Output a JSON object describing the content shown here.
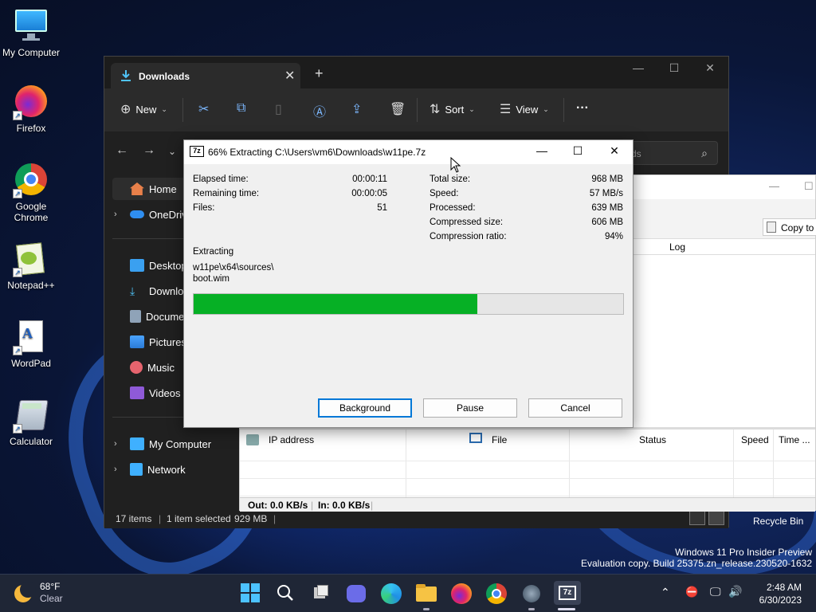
{
  "desktop": {
    "icons": [
      {
        "label": "My Computer"
      },
      {
        "label": "Firefox"
      },
      {
        "label": "Google Chrome"
      },
      {
        "label": "Notepad++"
      },
      {
        "label": "WordPad"
      },
      {
        "label": "Calculator"
      }
    ],
    "recycle_bin": "Recycle Bin",
    "watermark_line1": "Windows 11 Pro Insider Preview",
    "watermark_line2": "Evaluation copy. Build 25375.zn_release.230520-1632"
  },
  "explorer": {
    "tab_title": "Downloads",
    "toolbar": {
      "new_label": "New",
      "sort_label": "Sort",
      "view_label": "View"
    },
    "search_placeholder": "ds",
    "sidebar": {
      "items": [
        {
          "label": "Home"
        },
        {
          "label": "OneDriv"
        },
        {
          "label": "Desktop"
        },
        {
          "label": "Downloa"
        },
        {
          "label": "Docume"
        },
        {
          "label": "Pictures"
        },
        {
          "label": "Music"
        },
        {
          "label": "Videos"
        },
        {
          "label": "My Computer"
        },
        {
          "label": "Network"
        }
      ]
    },
    "status": {
      "items": "17 items",
      "selected": "1 item selected",
      "size": "929 MB"
    }
  },
  "network_window": {
    "copy_to": "Copy to",
    "log_header": "Log",
    "columns": [
      "IP address",
      "File",
      "Status",
      "Speed",
      "Time ..."
    ],
    "out_speed": "Out: 0.0 KB/s",
    "in_speed": "In: 0.0 KB/s"
  },
  "zip_dialog": {
    "title": "66% Extracting C:\\Users\\vm6\\Downloads\\w11pe.7z",
    "left_stats": [
      {
        "label": "Elapsed time:",
        "value": "00:00:11"
      },
      {
        "label": "Remaining time:",
        "value": "00:00:05"
      },
      {
        "label": "Files:",
        "value": "51"
      }
    ],
    "right_stats": [
      {
        "label": "Total size:",
        "value": "968 MB"
      },
      {
        "label": "Speed:",
        "value": "57 MB/s"
      },
      {
        "label": "Processed:",
        "value": "639 MB"
      },
      {
        "label": "Compressed size:",
        "value": "606 MB"
      },
      {
        "label": "Compression ratio:",
        "value": "94%"
      }
    ],
    "extracting_label": "Extracting",
    "path_line1": "w11pe\\x64\\sources\\",
    "path_line2": "boot.wim",
    "progress_fraction": 0.66,
    "buttons": {
      "background": "Background",
      "pause": "Pause",
      "cancel": "Cancel"
    }
  },
  "taskbar": {
    "weather_temp": "68°F",
    "weather_desc": "Clear",
    "time": "2:48 AM",
    "date": "6/30/2023"
  },
  "colors": {
    "progress_fill": "#06b025",
    "accent": "#0078d7"
  }
}
